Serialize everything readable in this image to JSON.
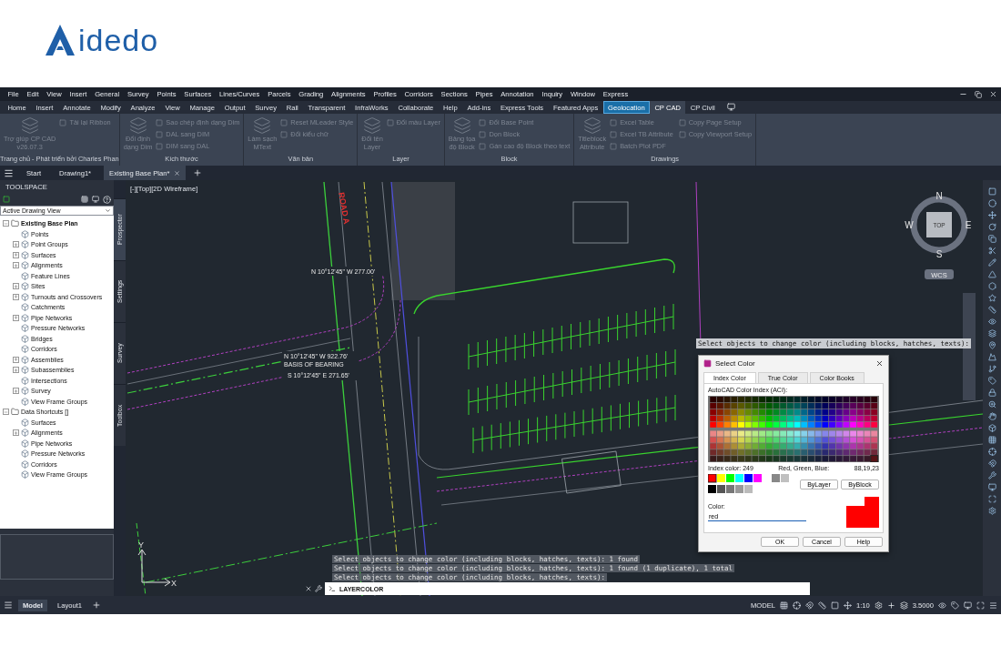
{
  "logo": {
    "text": "idedo"
  },
  "menu": [
    "File",
    "Edit",
    "View",
    "Insert",
    "General",
    "Survey",
    "Points",
    "Surfaces",
    "Lines/Curves",
    "Parcels",
    "Grading",
    "Alignments",
    "Profiles",
    "Corridors",
    "Sections",
    "Pipes",
    "Annotation",
    "Inquiry",
    "Window",
    "Express"
  ],
  "ribbon_tabs": [
    {
      "label": "Home",
      "selected": false,
      "highlighted": false
    },
    {
      "label": "Insert",
      "selected": false,
      "highlighted": false
    },
    {
      "label": "Annotate",
      "selected": false,
      "highlighted": false
    },
    {
      "label": "Modify",
      "selected": false,
      "highlighted": false
    },
    {
      "label": "Analyze",
      "selected": false,
      "highlighted": false
    },
    {
      "label": "View",
      "selected": false,
      "highlighted": false
    },
    {
      "label": "Manage",
      "selected": false,
      "highlighted": false
    },
    {
      "label": "Output",
      "selected": false,
      "highlighted": false
    },
    {
      "label": "Survey",
      "selected": false,
      "highlighted": false
    },
    {
      "label": "Rail",
      "selected": false,
      "highlighted": false
    },
    {
      "label": "Transparent",
      "selected": false,
      "highlighted": false
    },
    {
      "label": "InfraWorks",
      "selected": false,
      "highlighted": false
    },
    {
      "label": "Collaborate",
      "selected": false,
      "highlighted": false
    },
    {
      "label": "Help",
      "selected": false,
      "highlighted": false
    },
    {
      "label": "Add-ins",
      "selected": false,
      "highlighted": false
    },
    {
      "label": "Express Tools",
      "selected": false,
      "highlighted": false
    },
    {
      "label": "Featured Apps",
      "selected": false,
      "highlighted": false
    },
    {
      "label": "Geolocation",
      "selected": false,
      "highlighted": true
    },
    {
      "label": "CP CAD",
      "selected": true,
      "highlighted": false
    },
    {
      "label": "CP Civil",
      "selected": false,
      "highlighted": false
    }
  ],
  "ribbon_panels": [
    {
      "title": "Trang chủ - Phát triển bởi Charles Phan",
      "disabled": true,
      "big": [
        "Trợ giúp CP CAD\nv26.07.3"
      ],
      "small": [
        "Tải lại Ribbon"
      ]
    },
    {
      "title": "Kích thước",
      "disabled": true,
      "big": [
        "Đổi định\ndạng Dim"
      ],
      "small": [
        "Sao chép định dạng Dim",
        "DAL sang DIM",
        "DIM sang DAL"
      ]
    },
    {
      "title": "Văn bản",
      "disabled": true,
      "big": [
        "Làm sạch\nMText"
      ],
      "small": [
        "Reset MLeader Style",
        "Đổi kiểu chữ"
      ]
    },
    {
      "title": "Layer",
      "disabled": true,
      "big": [
        "Đổi tên\nLayer"
      ],
      "small": [
        "Đổi màu Layer"
      ]
    },
    {
      "title": "Block",
      "disabled": true,
      "big": [
        "Bảng tọa\nđộ Block"
      ],
      "small": [
        "Đổi Base Point",
        "Dọn Block",
        "Gán cao độ Block theo text"
      ]
    },
    {
      "title": "Drawings",
      "disabled": true,
      "big": [
        "Titleblock\nAttribute"
      ],
      "small": [
        "Excel Table",
        "Excel TB Attribute",
        "Batch Plot PDF",
        "Copy Page Setup",
        "Copy Viewport Setup"
      ]
    }
  ],
  "doc_tabs": [
    {
      "label": "Start",
      "selected": false
    },
    {
      "label": "Drawing1*",
      "selected": false
    },
    {
      "label": "Existing Base Plan*",
      "selected": true
    }
  ],
  "toolspace": {
    "title": "TOOLSPACE",
    "view": "Active Drawing View",
    "tree": [
      {
        "label": "Existing Base Plan",
        "expanded": true,
        "children": [
          {
            "label": "Points"
          },
          {
            "label": "Point Groups",
            "expanded": false
          },
          {
            "label": "Surfaces",
            "expanded": false
          },
          {
            "label": "Alignments",
            "expanded": false
          },
          {
            "label": "Feature Lines"
          },
          {
            "label": "Sites",
            "expanded": false
          },
          {
            "label": "Turnouts and Crossovers",
            "expanded": false
          },
          {
            "label": "Catchments"
          },
          {
            "label": "Pipe Networks",
            "expanded": false
          },
          {
            "label": "Pressure Networks"
          },
          {
            "label": "Bridges"
          },
          {
            "label": "Corridors"
          },
          {
            "label": "Assemblies",
            "expanded": false
          },
          {
            "label": "Subassemblies",
            "expanded": false
          },
          {
            "label": "Intersections"
          },
          {
            "label": "Survey",
            "expanded": false
          },
          {
            "label": "View Frame Groups"
          }
        ]
      },
      {
        "label": "Data Shortcuts []",
        "expanded": true,
        "children": [
          {
            "label": "Surfaces"
          },
          {
            "label": "Alignments",
            "expanded": false
          },
          {
            "label": "Pipe Networks"
          },
          {
            "label": "Pressure Networks"
          },
          {
            "label": "Corridors"
          },
          {
            "label": "View Frame Groups"
          }
        ]
      }
    ]
  },
  "side_tabs": [
    {
      "label": "Prospector",
      "selected": true
    },
    {
      "label": "Settings",
      "selected": false
    },
    {
      "label": "Survey",
      "selected": false
    },
    {
      "label": "Toolbox",
      "selected": false
    }
  ],
  "canvas": {
    "viewport_label": "[-][Top][2D Wireframe]",
    "road_label": "ROAD A",
    "bearings": [
      "N 10°12'45\" W 277.00'",
      "N 10°12'45\" W 922.76'",
      "BASIS OF BEARING",
      "S 10°12'45\" E 271.65'"
    ],
    "compass": {
      "north": "N",
      "south": "S",
      "east": "E",
      "west": "W",
      "top": "TOP",
      "ucs": "WCS"
    },
    "axes": {
      "x": "X",
      "y": "Y"
    }
  },
  "tooltip": "Select objects to change color (including blocks, hatches, texts):",
  "command": {
    "history": [
      "Select objects to change color (including blocks, hatches, texts): 1 found",
      "Select objects to change color (including blocks, hatches, texts): 1 found (1 duplicate), 1 total",
      "Select objects to change color (including blocks, hatches, texts):"
    ],
    "input": "LAYERCOLOR"
  },
  "dialog": {
    "title": "Select Color",
    "tabs": [
      {
        "label": "Index Color",
        "selected": true
      },
      {
        "label": "True Color",
        "selected": false
      },
      {
        "label": "Color Books",
        "selected": false
      }
    ],
    "palette_label": "AutoCAD Color Index (ACI):",
    "index_label": "Index color:",
    "index_value": "249",
    "rgb_label": "Red, Green, Blue:",
    "rgb_value": "88,19,23",
    "by_buttons": [
      "ByLayer",
      "ByBlock"
    ],
    "color_label": "Color:",
    "color_value": "red",
    "buttons": [
      "OK",
      "Cancel",
      "Help"
    ]
  },
  "status": {
    "layout_tabs": [
      {
        "label": "Model",
        "selected": true
      },
      {
        "label": "Layout1",
        "selected": false
      }
    ],
    "model": "MODEL",
    "scale": "1:10",
    "annotation_value": "3.5000"
  }
}
